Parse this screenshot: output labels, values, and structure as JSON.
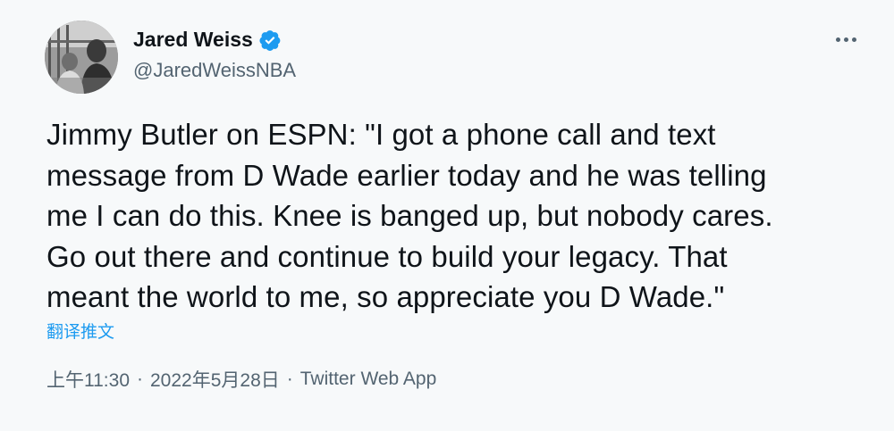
{
  "author": {
    "display_name": "Jared Weiss",
    "handle": "@JaredWeissNBA",
    "verified": true,
    "avatar_icon": "profile-photo",
    "verified_icon": "verified-badge-icon",
    "verified_color": "#1d9bf0"
  },
  "more_icon": "more-horizontal-icon",
  "tweet": {
    "text_lines": [
      "Jimmy Butler on ESPN: \"I got a phone call and text",
      "message from D Wade earlier today and he was telling",
      "me I can do this. Knee is banged up, but nobody cares.",
      "Go out there and continue to build your legacy. That",
      "meant the world to me, so appreciate you D Wade.\""
    ],
    "translate_label": "翻译推文"
  },
  "meta": {
    "time": "上午11:30",
    "separator": "·",
    "date": "2022年5月28日",
    "source": "Twitter Web App"
  },
  "colors": {
    "background": "#f7f9fa",
    "text": "#0f1419",
    "secondary": "#536471",
    "link": "#1d9bf0"
  }
}
